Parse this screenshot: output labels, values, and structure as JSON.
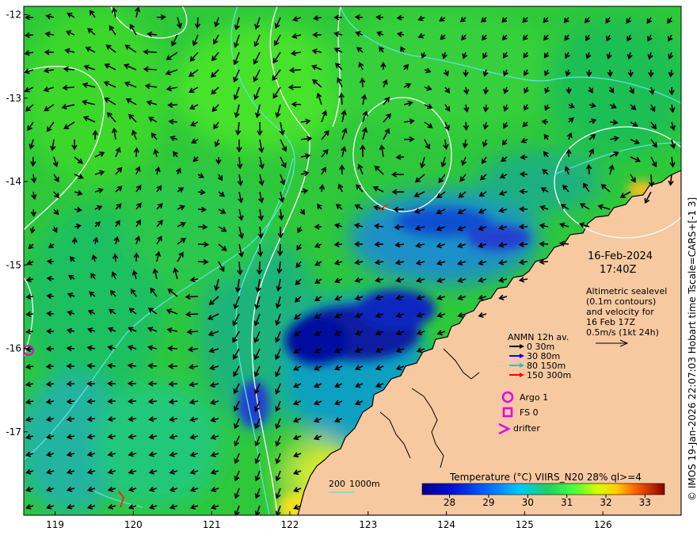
{
  "map": {
    "lon_ticks": [
      "119",
      "120",
      "121",
      "122",
      "123",
      "124",
      "125",
      "126"
    ],
    "lat_ticks": [
      "-12",
      "-13",
      "-14",
      "-15",
      "-16",
      "-17"
    ],
    "lon_range": [
      118.6,
      127.0
    ],
    "lat_range": [
      -11.9,
      -18.0
    ],
    "colors": {
      "land": "#f7c9a0",
      "contour_white": "#ffffff",
      "contour_cyan": "#5fe0e0",
      "argo": "#e600e6"
    }
  },
  "annotation": {
    "date": "16-Feb-2024",
    "time": "17:40Z",
    "altimetry_lines": [
      "Altimetric sealevel",
      "(0.1m contours)",
      "and velocity for",
      "16 Feb 17Z",
      "0.5m/s (1kt 24h)"
    ]
  },
  "legend": {
    "title": "ANMN 12h av.",
    "items": [
      {
        "label": "0 30m",
        "color": "#000000"
      },
      {
        "label": "30 80m",
        "color": "#0000ff"
      },
      {
        "label": "80 150m",
        "color": "#00cccc"
      },
      {
        "label": "150 300m",
        "color": "#ff0000"
      }
    ],
    "argo_label": "Argo 1",
    "fs_label": "FS 0",
    "drifter_label": "drifter"
  },
  "colorbar": {
    "title": "Temperature (°C) VIIRS_N20 28% ql>=4",
    "ticks": [
      "28",
      "29",
      "30",
      "31",
      "32",
      "33"
    ],
    "range": [
      27.3,
      33.5
    ]
  },
  "depth_legend": {
    "label_200": "200",
    "label_1000": "1000m"
  },
  "credit": "© IMOS 19-Jan-2026 22:07:03 Hobart time Tscale=CARS+[-1 3]"
}
